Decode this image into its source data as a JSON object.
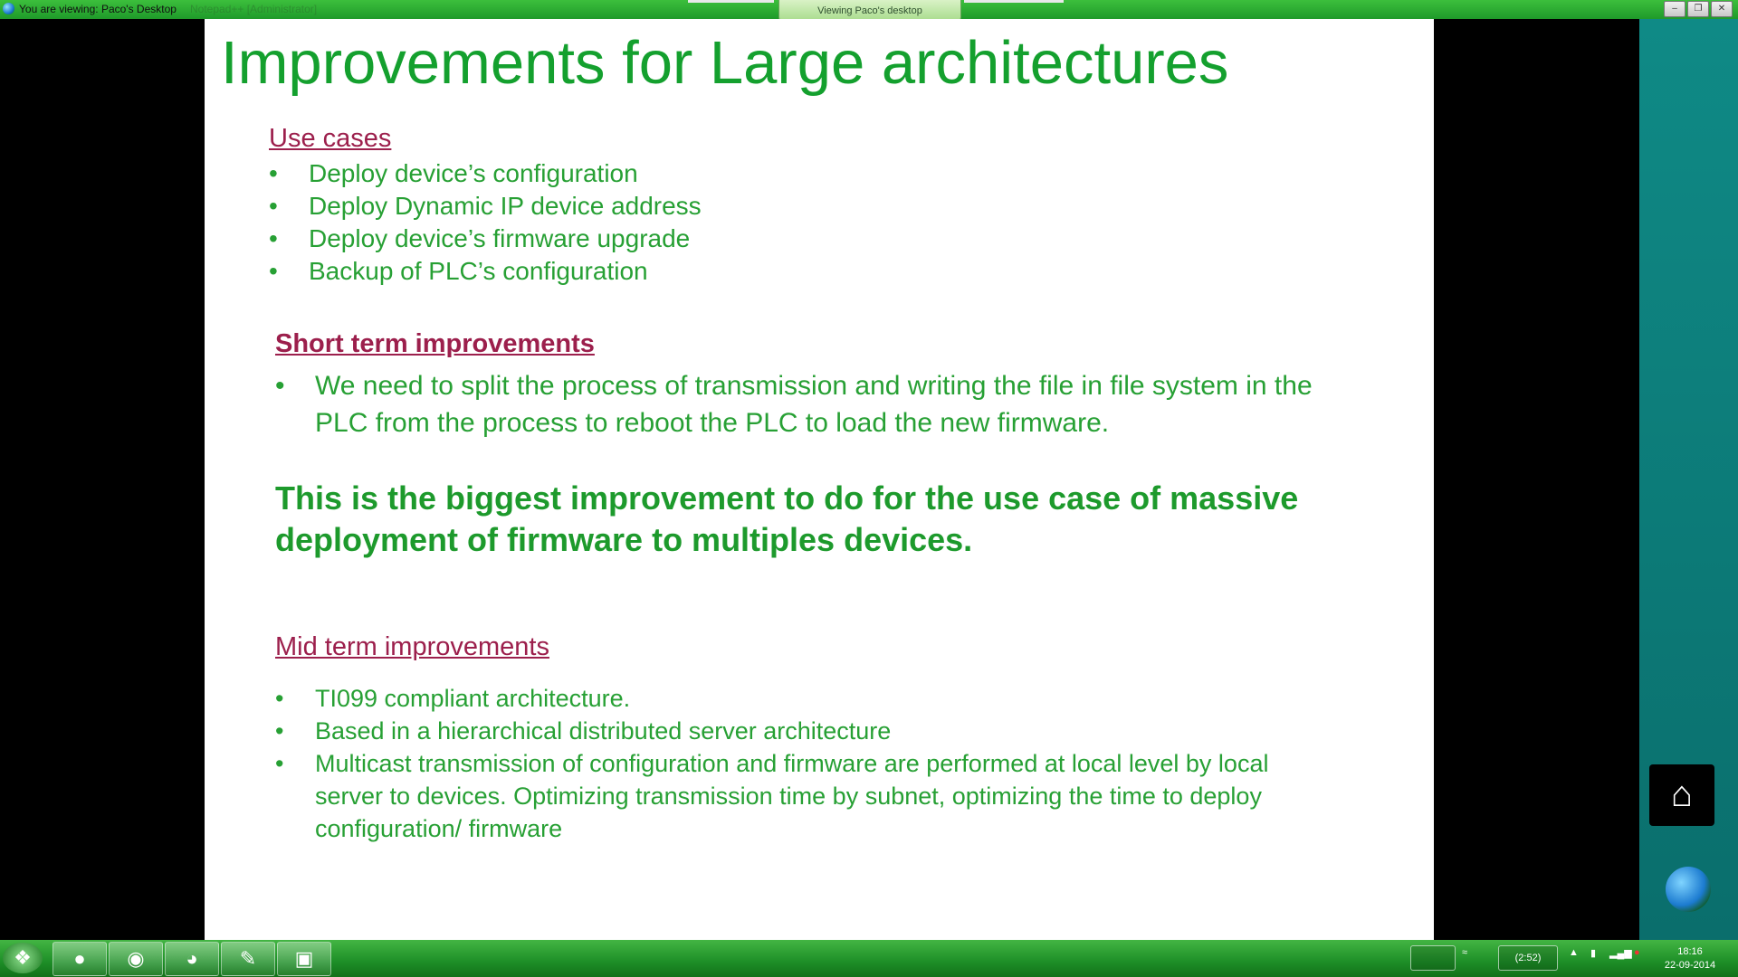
{
  "titlebar": {
    "title": "You are viewing: Paco's Desktop",
    "faded_text": "Notepad++ [Administrator]",
    "viewing_tab": "Viewing Paco's desktop"
  },
  "slide": {
    "title": "Improvements for Large architectures",
    "use_cases": {
      "heading": "Use cases",
      "items": [
        "Deploy device’s configuration",
        "Deploy Dynamic IP device address",
        "Deploy device’s firmware upgrade",
        "Backup of PLC’s configuration"
      ]
    },
    "short_term": {
      "heading": "Short term improvements",
      "items": [
        "We need to split the process of transmission and writing the file in file system in the PLC from the process to reboot the PLC to load the new firmware."
      ],
      "emphasis": "This is the biggest improvement to do for the use case of massive deployment of firmware to multiples devices."
    },
    "mid_term": {
      "heading": "Mid term improvements",
      "items": [
        "TI099 compliant architecture.",
        "Based in a hierarchical distributed server architecture",
        "Multicast transmission of configuration and firmware are performed at local level by local server to devices. Optimizing transmission time by subnet, optimizing the time to deploy configuration/ firmware"
      ]
    },
    "bullet": "•"
  },
  "taskbar": {
    "battery_time": "(2:52)",
    "time": "18:16",
    "date": "22-09-2014"
  }
}
